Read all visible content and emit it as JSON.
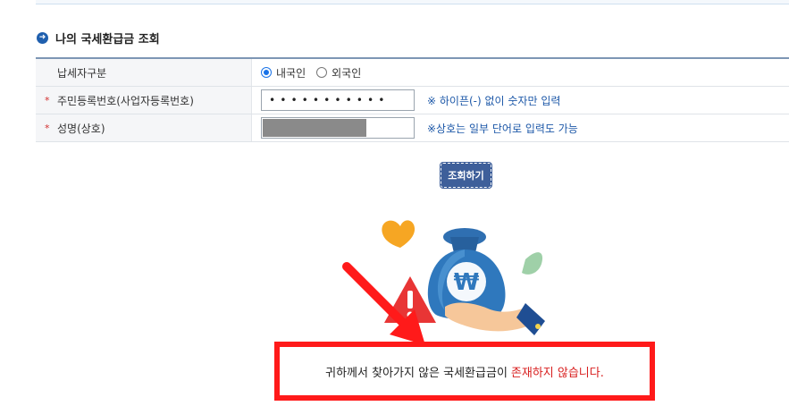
{
  "section": {
    "title": "나의 국세환급금 조회"
  },
  "form": {
    "taxpayer_type_label": "납세자구분",
    "radio_domestic": "내국인",
    "radio_foreign": "외국인",
    "selected_type": "내국인",
    "id_label": "주민등록번호(사업자등록번호)",
    "id_value": "•••••••••••",
    "id_hint": "※ 하이픈(-) 없이 숫자만 입력",
    "name_label": "성명(상호)",
    "name_hint": "※상호는 일부 단어로 입력도 가능",
    "required_mark": "*"
  },
  "search_button": {
    "label": "조회하기"
  },
  "result": {
    "message_prefix": "귀하께서 찾아가지 않은 국세환급금이",
    "message_highlight": "존재하지 않습니다."
  },
  "colors": {
    "accent": "#1d58a8",
    "button": "#3e5f9a",
    "alert": "#ff1a1a"
  }
}
